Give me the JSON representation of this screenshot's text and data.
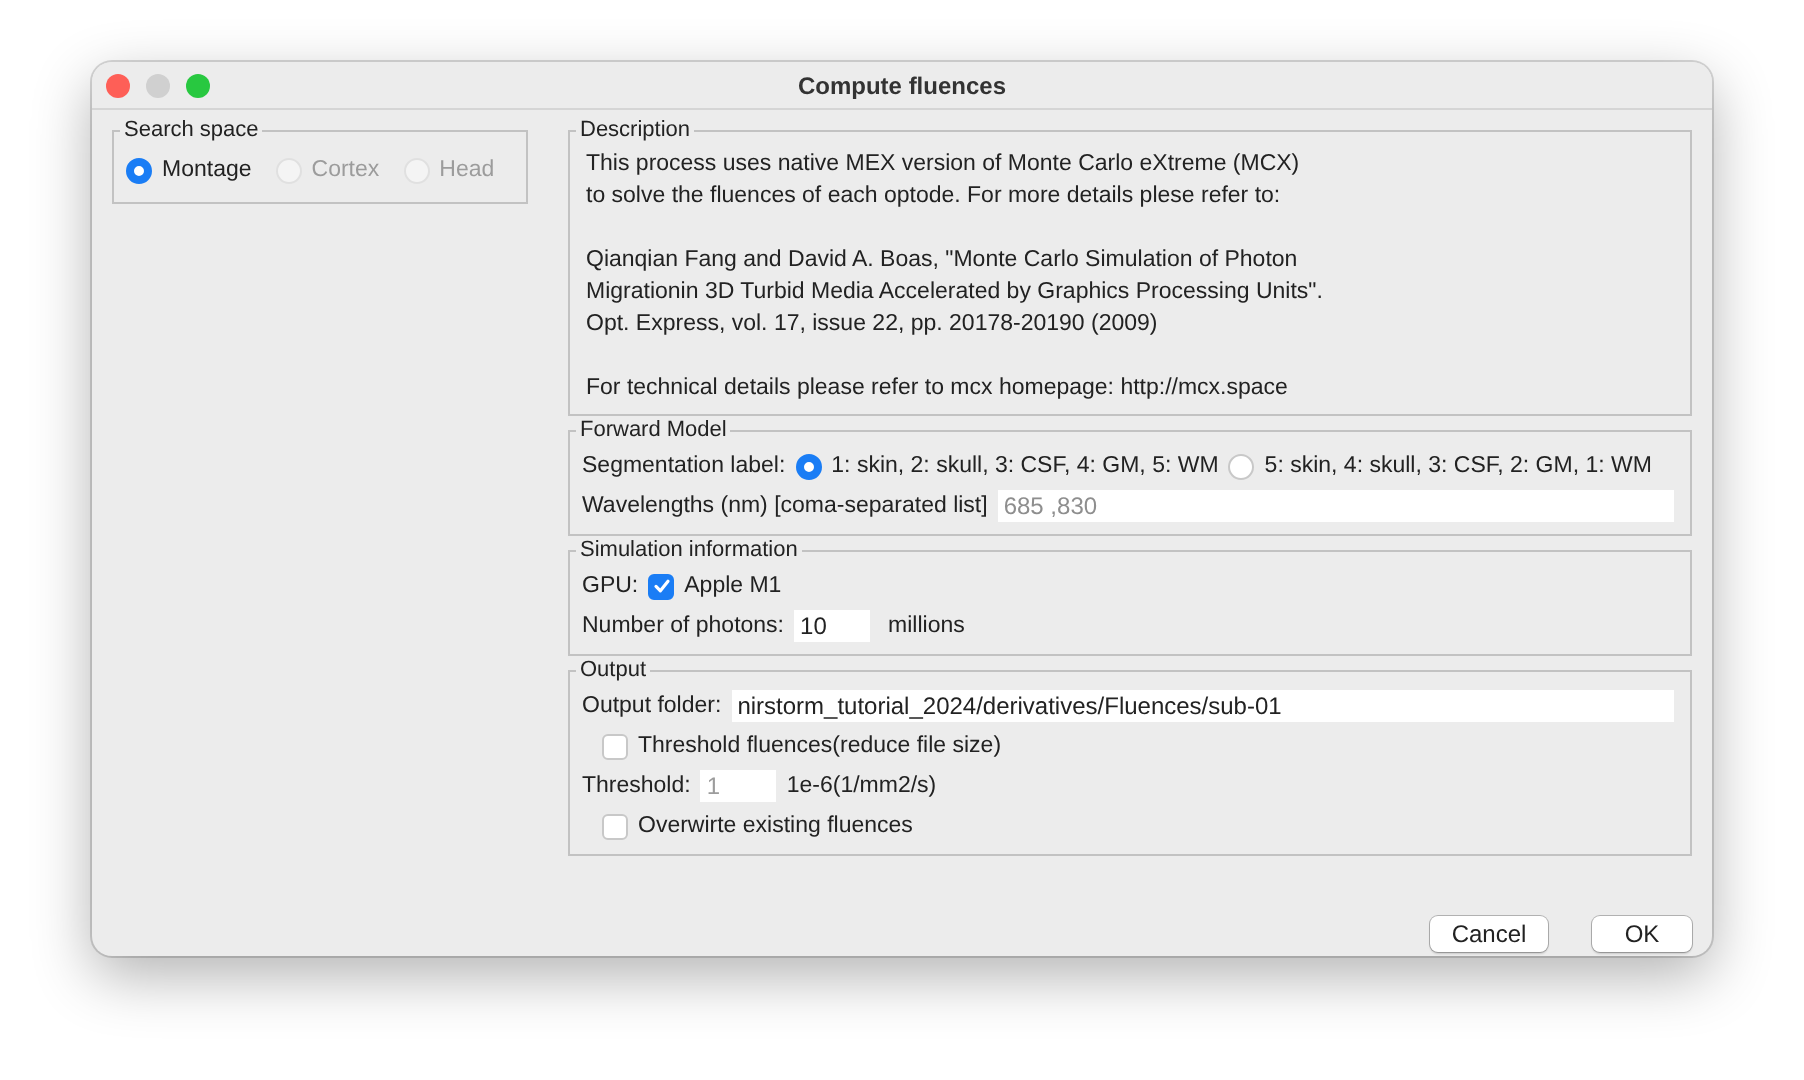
{
  "window": {
    "title": "Compute fluences"
  },
  "search_space": {
    "title": "Search space",
    "options": [
      {
        "label": "Montage",
        "selected": true,
        "disabled": false
      },
      {
        "label": "Cortex",
        "selected": false,
        "disabled": true
      },
      {
        "label": "Head",
        "selected": false,
        "disabled": true
      }
    ]
  },
  "description": {
    "title": "Description",
    "paragraphs": [
      [
        "This process uses native MEX version of Monte Carlo eXtreme (MCX)",
        "to solve the fluences of each optode. For more details plese refer to:"
      ],
      [
        "Qianqian Fang and David A. Boas, \"Monte Carlo Simulation of Photon",
        "Migrationin 3D Turbid Media Accelerated by Graphics Processing Units\".",
        "Opt. Express, vol. 17, issue 22, pp. 20178-20190 (2009)"
      ],
      [
        "For technical details please refer to mcx homepage: http://mcx.space"
      ]
    ]
  },
  "forward_model": {
    "title": "Forward Model",
    "segmentation_label": "Segmentation label:",
    "options": [
      {
        "label": "1: skin, 2: skull, 3: CSF, 4: GM, 5: WM",
        "selected": true
      },
      {
        "label": "5: skin, 4: skull, 3: CSF, 2: GM, 1: WM",
        "selected": false
      }
    ],
    "wavelengths": {
      "label": "Wavelengths (nm) [coma-separated list]",
      "placeholder": "685 ,830"
    }
  },
  "simulation": {
    "title": "Simulation information",
    "gpu_label": "GPU:",
    "gpu": {
      "label": "Apple M1",
      "checked": true
    },
    "photons": {
      "label": "Number of photons:",
      "value": "10",
      "unit": "millions"
    }
  },
  "output": {
    "title": "Output",
    "folder": {
      "label": "Output folder:",
      "value": "nirstorm_tutorial_2024/derivatives/Fluences/sub-01"
    },
    "threshold_check": {
      "label": "Threshold fluences(reduce file size)",
      "checked": false
    },
    "threshold": {
      "label": "Threshold:",
      "value": "1",
      "disabled": true,
      "unit": "1e-6(1/mm2/s)"
    },
    "overwrite": {
      "label": "Overwirte existing fluences",
      "checked": false
    }
  },
  "buttons": [
    {
      "label": "Cancel"
    },
    {
      "label": "OK"
    }
  ]
}
